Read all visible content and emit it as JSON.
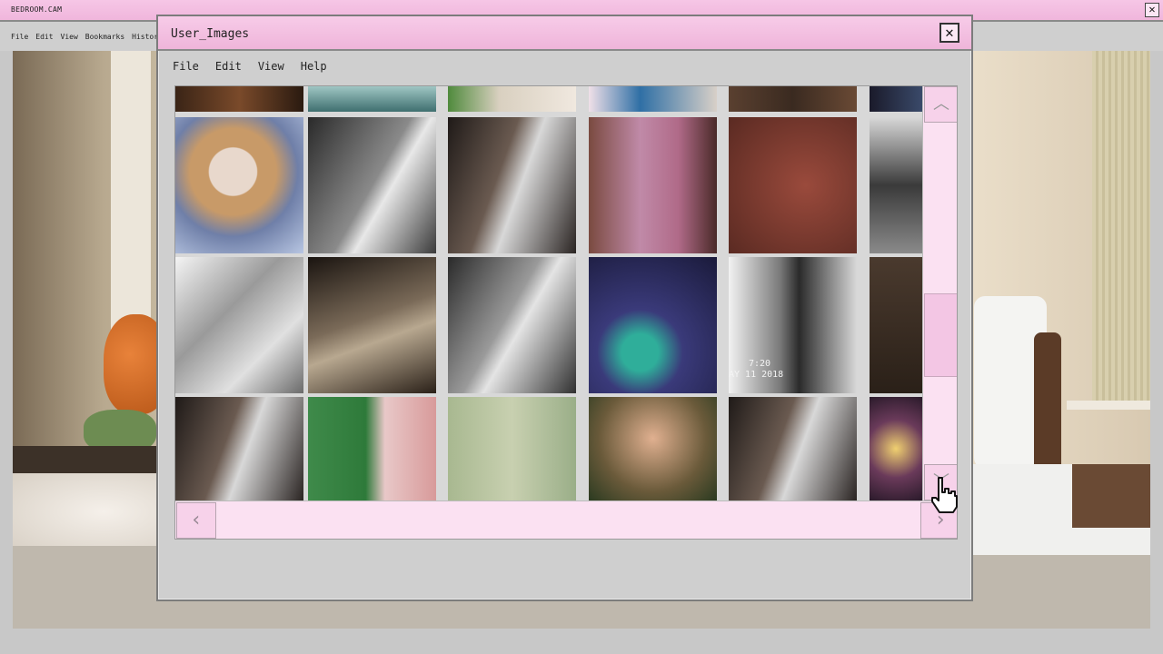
{
  "outer_window": {
    "title": "BEDROOM.CAM",
    "menu": [
      "File",
      "Edit",
      "View",
      "Bookmarks",
      "History"
    ]
  },
  "dialog": {
    "title": "User_Images",
    "menu": [
      "File",
      "Edit",
      "View",
      "Help"
    ],
    "close_icon": "close-icon"
  },
  "overlay_text": {
    "timestamp_time": "7:20",
    "timestamp_date": "AY 11 2018"
  },
  "scrollbars": {
    "up_icon": "chevron-up-icon",
    "down_icon": "chevron-down-icon",
    "left_icon": "chevron-left-icon",
    "right_icon": "chevron-right-icon",
    "vertical_position": 0.35,
    "horizontal_position": 0.0
  },
  "colors": {
    "titlebar_pink": "#f2bde0",
    "scroll_pink": "#fbe1f2"
  }
}
